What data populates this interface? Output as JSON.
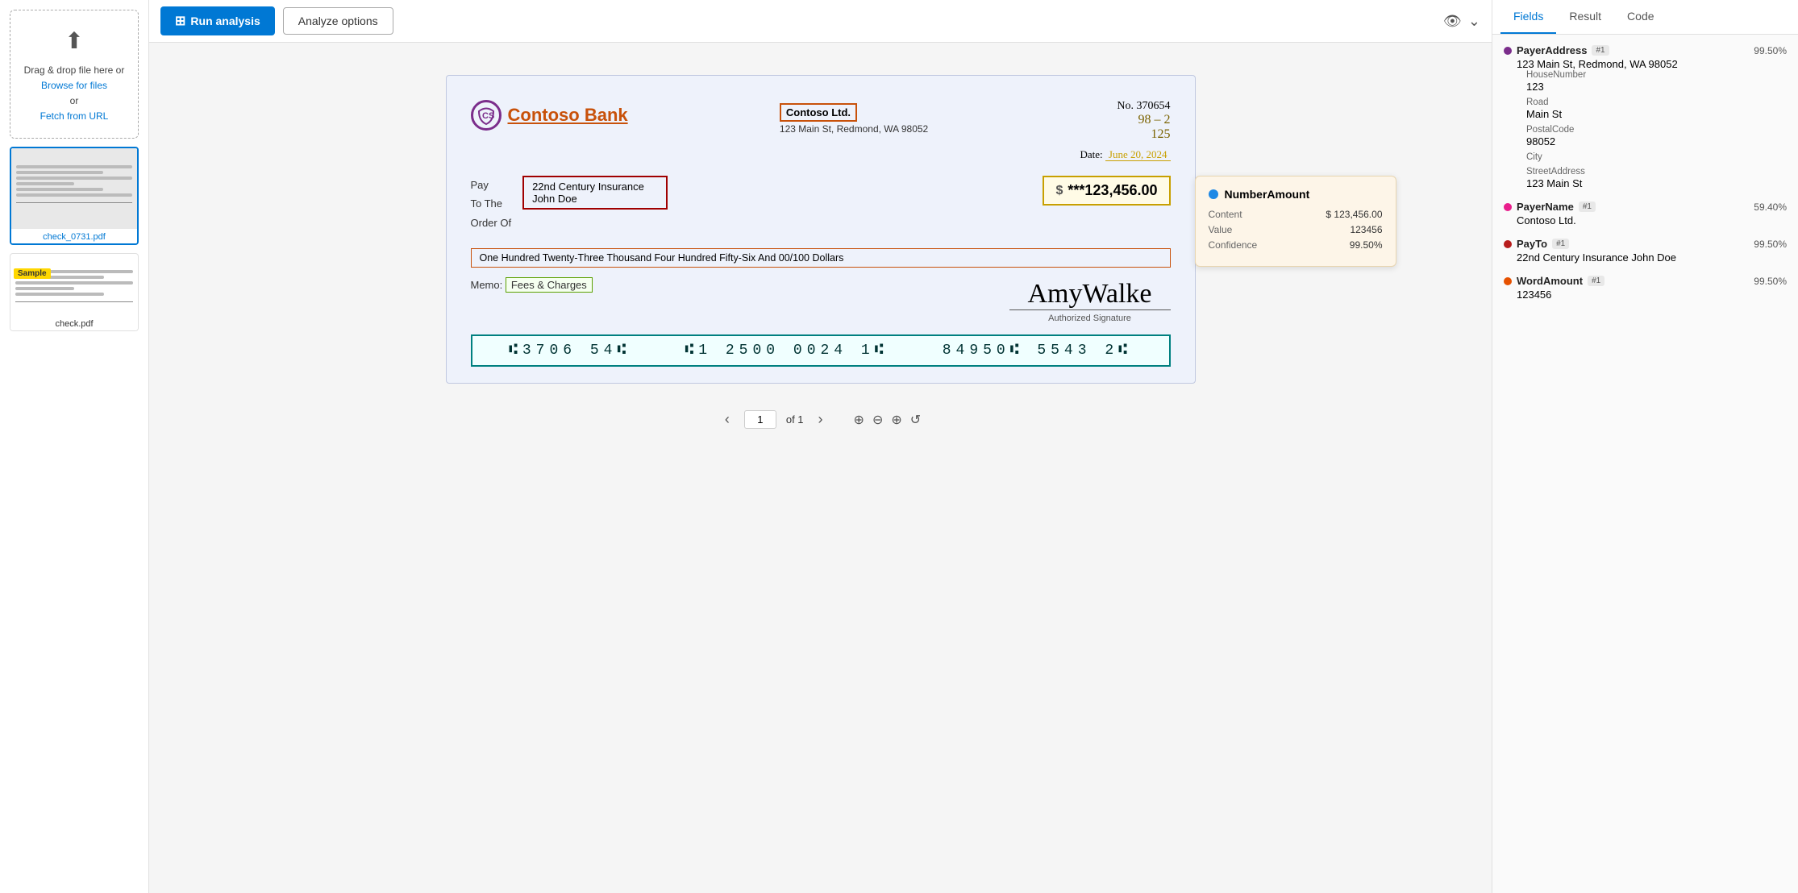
{
  "sidebar": {
    "drop_label": "Drag & drop file here or",
    "browse_label": "Browse for files",
    "or_label": "or",
    "fetch_label": "Fetch from URL",
    "file1_name": "check_0731.pdf",
    "file2_name": "check.pdf",
    "sample_badge": "Sample"
  },
  "toolbar": {
    "run_label": "Run analysis",
    "analyze_label": "Analyze options"
  },
  "tabs": {
    "fields": "Fields",
    "result": "Result",
    "code": "Code",
    "active": "Fields"
  },
  "check": {
    "bank_name": "Contoso Bank",
    "payee_name": "Contoso Ltd.",
    "payee_address": "123 Main St, Redmond, WA 98052",
    "check_no_label": "No.",
    "check_no": "370654",
    "fraction": "98 – 2",
    "fraction2": "125",
    "date_label": "Date:",
    "date_val": "June 20, 2024",
    "pay_label": "Pay",
    "to_the_label": "To The",
    "order_label": "Order Of",
    "payto_line1": "22nd Century Insurance",
    "payto_line2": "John Doe",
    "dollar_sign": "$",
    "amount": "***123,456.00",
    "word_amount": "One Hundred Twenty-Three Thousand Four Hundred Fifty-Six And 00/100    Dollars",
    "memo_label": "Memo:",
    "memo_val": "Fees & Charges",
    "micr": "\"3706 54\"    ⑆1 2500 0024 1⑆    84950\" 5543 2\"",
    "sig_label": "Authorized Signature"
  },
  "tooltip": {
    "title": "NumberAmount",
    "content_label": "Content",
    "content_val": "$ 123,456.00",
    "value_label": "Value",
    "value_val": "123456",
    "confidence_label": "Confidence",
    "confidence_val": "99.50%"
  },
  "fields": [
    {
      "dot_color": "#7b2d8b",
      "name": "PayerAddress",
      "badge": "#1",
      "confidence": "99.50%",
      "value": "123 Main St, Redmond, WA 98052",
      "subfields": [
        {
          "label": "HouseNumber",
          "value": "123"
        },
        {
          "label": "Road",
          "value": "Main St"
        },
        {
          "label": "PostalCode",
          "value": "98052"
        },
        {
          "label": "City",
          "value": ""
        },
        {
          "label": "StreetAddress",
          "value": "123 Main St"
        }
      ]
    },
    {
      "dot_color": "#e91e8c",
      "name": "PayerName",
      "badge": "#1",
      "confidence": "59.40%",
      "value": "Contoso Ltd.",
      "subfields": []
    },
    {
      "dot_color": "#b71c1c",
      "name": "PayTo",
      "badge": "#1",
      "confidence": "99.50%",
      "value": "22nd Century Insurance John Doe",
      "subfields": []
    },
    {
      "dot_color": "#e65100",
      "name": "WordAmount",
      "badge": "#1",
      "confidence": "99.50%",
      "value": "123456",
      "subfields": []
    }
  ],
  "pagination": {
    "page": "1",
    "total": "of 1"
  }
}
